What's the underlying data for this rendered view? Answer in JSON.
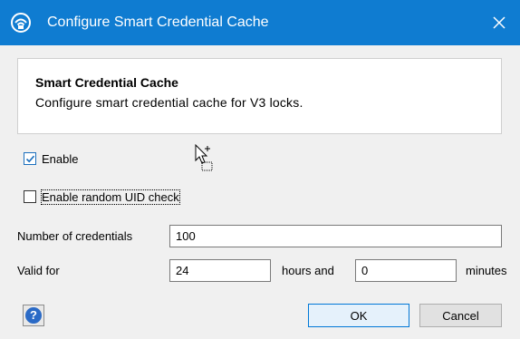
{
  "window": {
    "title": "Configure Smart Credential Cache",
    "icon": "wifi-lock-icon",
    "close_icon": "close-icon"
  },
  "header": {
    "title": "Smart Credential Cache",
    "description": "Configure smart credential cache for V3 locks."
  },
  "options": {
    "enable": {
      "label": "Enable",
      "checked": true
    },
    "random_uid": {
      "label": "Enable random UID check",
      "checked": false
    }
  },
  "form": {
    "num_credentials": {
      "label": "Number of credentials",
      "value": "100"
    },
    "valid_for": {
      "label": "Valid for",
      "hours_value": "24",
      "hours_label": "hours and",
      "minutes_value": "0",
      "minutes_label": "minutes"
    }
  },
  "footer": {
    "help_icon": "help-icon",
    "help_glyph": "?",
    "ok_label": "OK",
    "cancel_label": "Cancel"
  },
  "colors": {
    "titlebar": "#0f7cd1",
    "accent": "#0078d7"
  }
}
